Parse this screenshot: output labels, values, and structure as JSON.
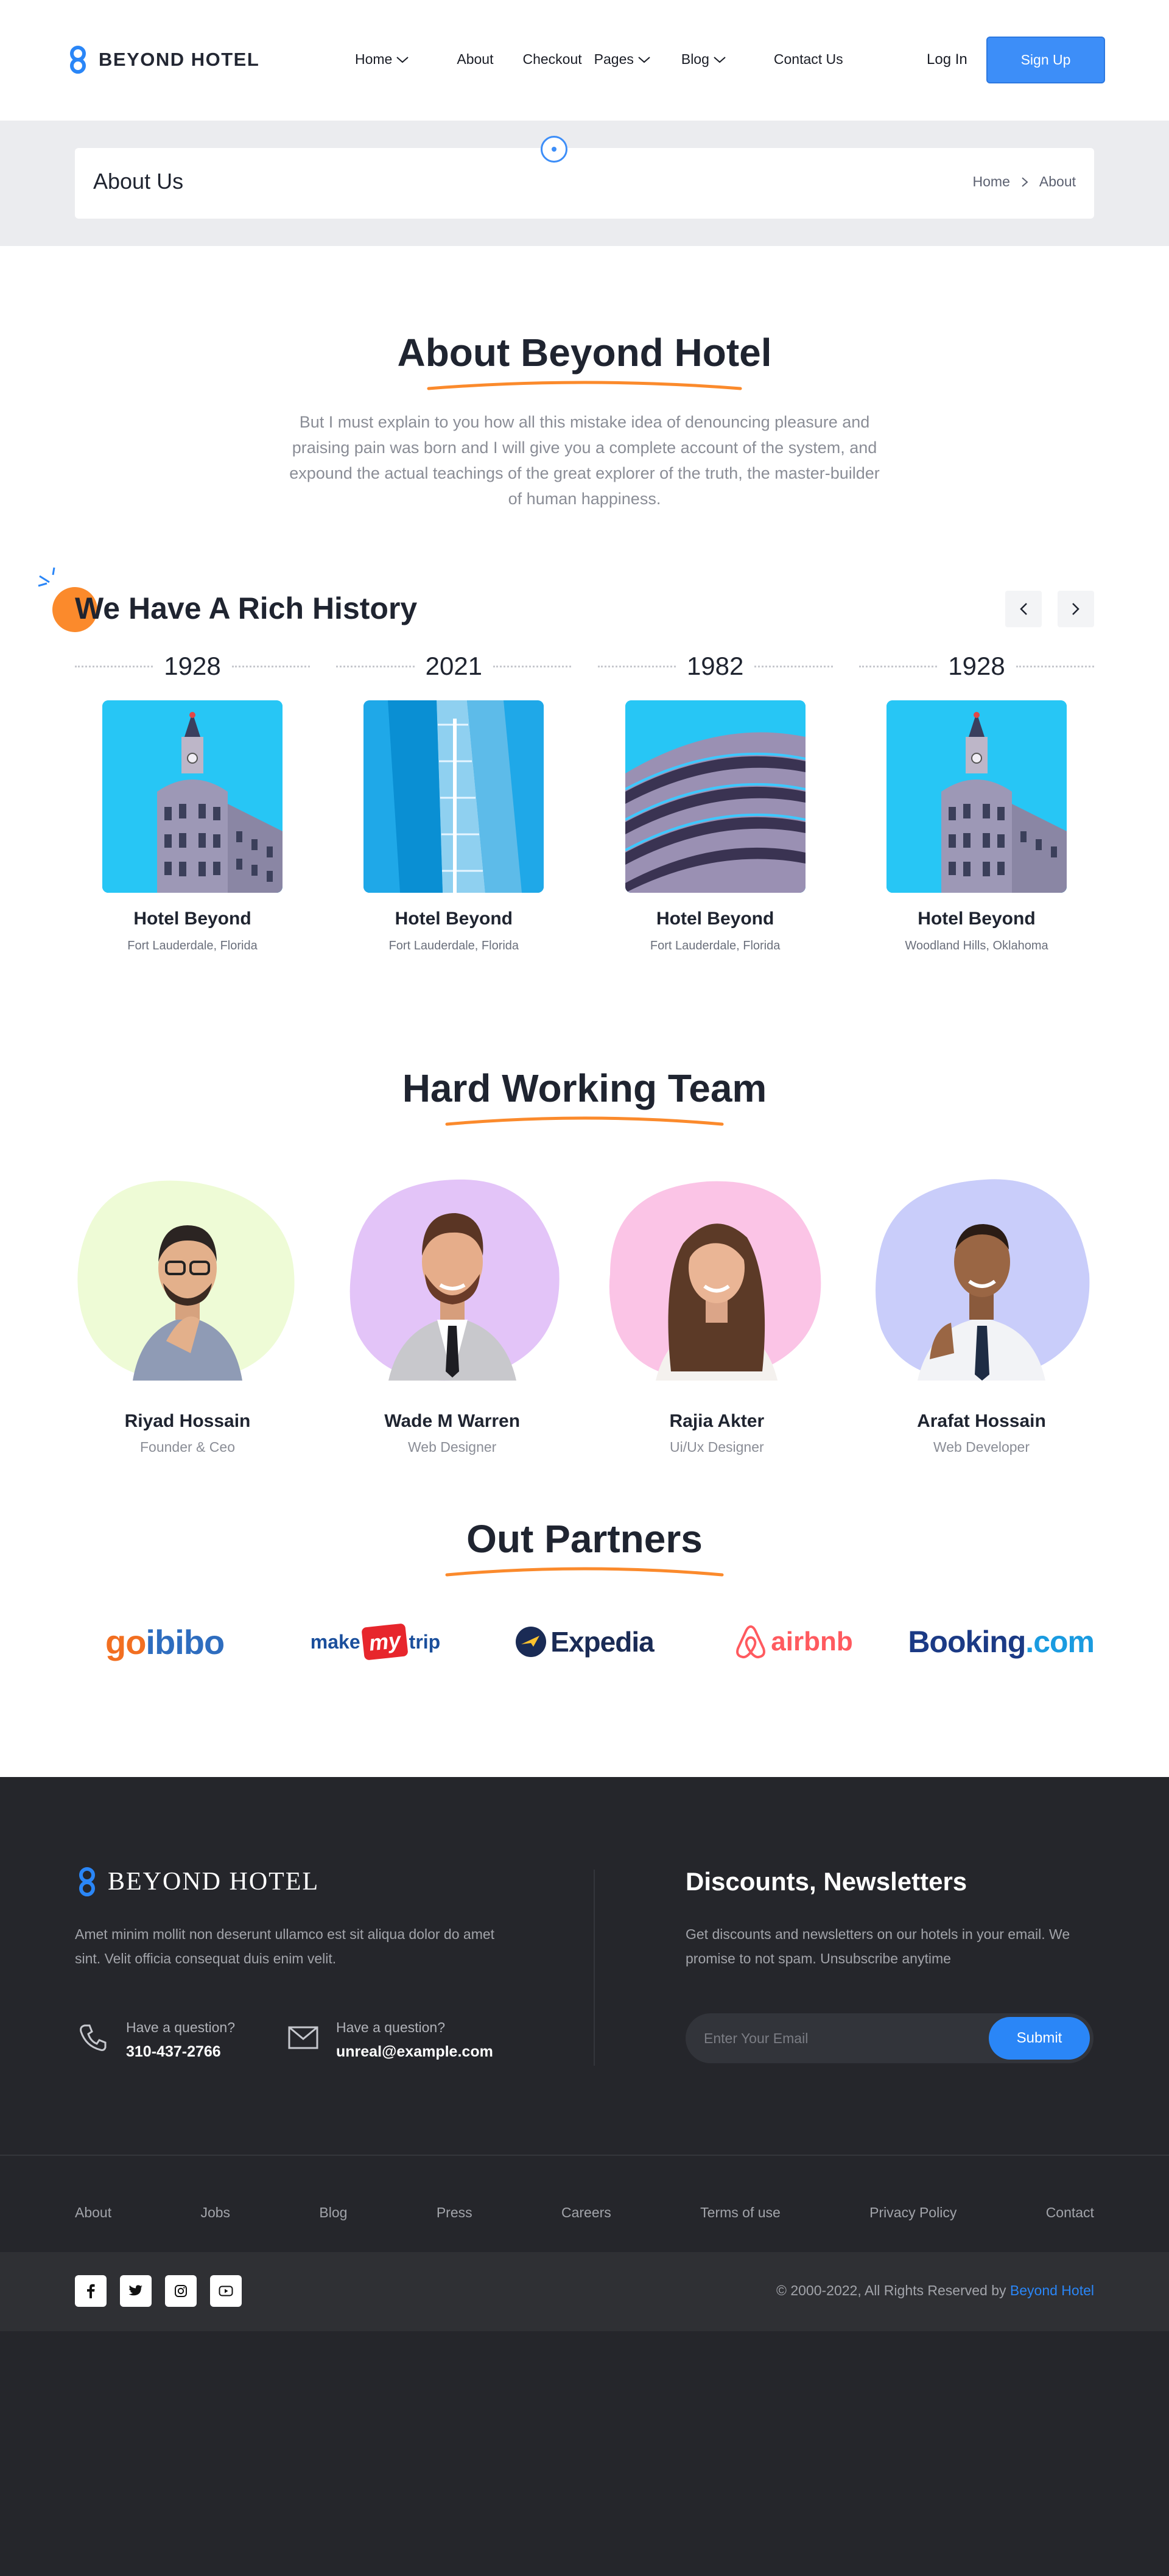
{
  "header": {
    "brand": "BEYOND HOTEL",
    "nav": [
      {
        "label": "Home",
        "dropdown": true
      },
      {
        "label": "About",
        "dropdown": false
      },
      {
        "label": "Checkout",
        "dropdown": false
      },
      {
        "label": "Pages",
        "dropdown": true
      },
      {
        "label": "Blog",
        "dropdown": true
      },
      {
        "label": "Contact Us",
        "dropdown": false
      }
    ],
    "login": "Log In",
    "signup": "Sign Up"
  },
  "banner": {
    "title": "About Us",
    "crumbs": [
      "Home",
      "About"
    ]
  },
  "about": {
    "title": "About Beyond Hotel",
    "text": "But I must explain to you how all this mistake idea of denouncing pleasure and praising pain was born and I will give you a complete account of the system, and expound the actual teachings of the great explorer of the truth, the master-builder of human happiness."
  },
  "history": {
    "title": "We Have A Rich History",
    "items": [
      {
        "year": "1928",
        "name": "Hotel Beyond",
        "location": "Fort Lauderdale, Florida",
        "image": "clock-tower-building"
      },
      {
        "year": "2021",
        "name": "Hotel Beyond",
        "location": "Fort Lauderdale, Florida",
        "image": "glass-facade-building"
      },
      {
        "year": "1982",
        "name": "Hotel Beyond",
        "location": "Fort Lauderdale, Florida",
        "image": "balcony-building"
      },
      {
        "year": "1928",
        "name": "Hotel Beyond",
        "location": "Woodland Hills, Oklahoma",
        "image": "clock-tower-building"
      }
    ]
  },
  "team": {
    "title": "Hard Working Team",
    "members": [
      {
        "name": "Riyad Hossain",
        "role": "Founder & Ceo",
        "color": "#eefbd6"
      },
      {
        "name": "Wade M Warren",
        "role": "Web Designer",
        "color": "#e3c4f8"
      },
      {
        "name": "Rajia Akter",
        "role": "Ui/Ux Designer",
        "color": "#fbc4e6"
      },
      {
        "name": "Arafat Hossain",
        "role": "Web Developer",
        "color": "#c9cdfa"
      }
    ]
  },
  "partners": {
    "title": "Out Partners",
    "logos": [
      {
        "part1": "go",
        "part2": "ibibo"
      },
      {
        "part1": "make",
        "part2": "my",
        "part3": "trip"
      },
      {
        "part1": "Expedia"
      },
      {
        "part1": "airbnb"
      },
      {
        "part1": "Booking",
        "part2": ".com"
      }
    ]
  },
  "footer": {
    "brand": "BEYOND HOTEL",
    "description": "Amet minim mollit non deserunt ullamco est sit aliqua dolor do amet sint. Velit officia consequat duis enim velit.",
    "phone_label": "Have a question?",
    "phone": "310-437-2766",
    "email_label": "Have a question?",
    "email": "unreal@example.com",
    "newsletter_title": "Discounts, Newsletters",
    "newsletter_desc": "Get discounts and newsletters on our hotels in your email. We promise to not spam. Unsubscribe anytime",
    "email_placeholder": "Enter Your Email",
    "submit": "Submit",
    "links": [
      "About",
      "Jobs",
      "Blog",
      "Press",
      "Careers",
      "Terms of use",
      "Privacy Policy",
      "Contact"
    ],
    "socials": [
      "facebook-icon",
      "twitter-icon",
      "instagram-icon",
      "youtube-icon"
    ],
    "copyright": "© 2000-2022, All Rights Reserved by",
    "copyright_brand": "Beyond Hotel"
  },
  "colors": {
    "accent": "#3d8ef8",
    "orange": "#fb8a2c",
    "footer_bg": "#25262b"
  }
}
